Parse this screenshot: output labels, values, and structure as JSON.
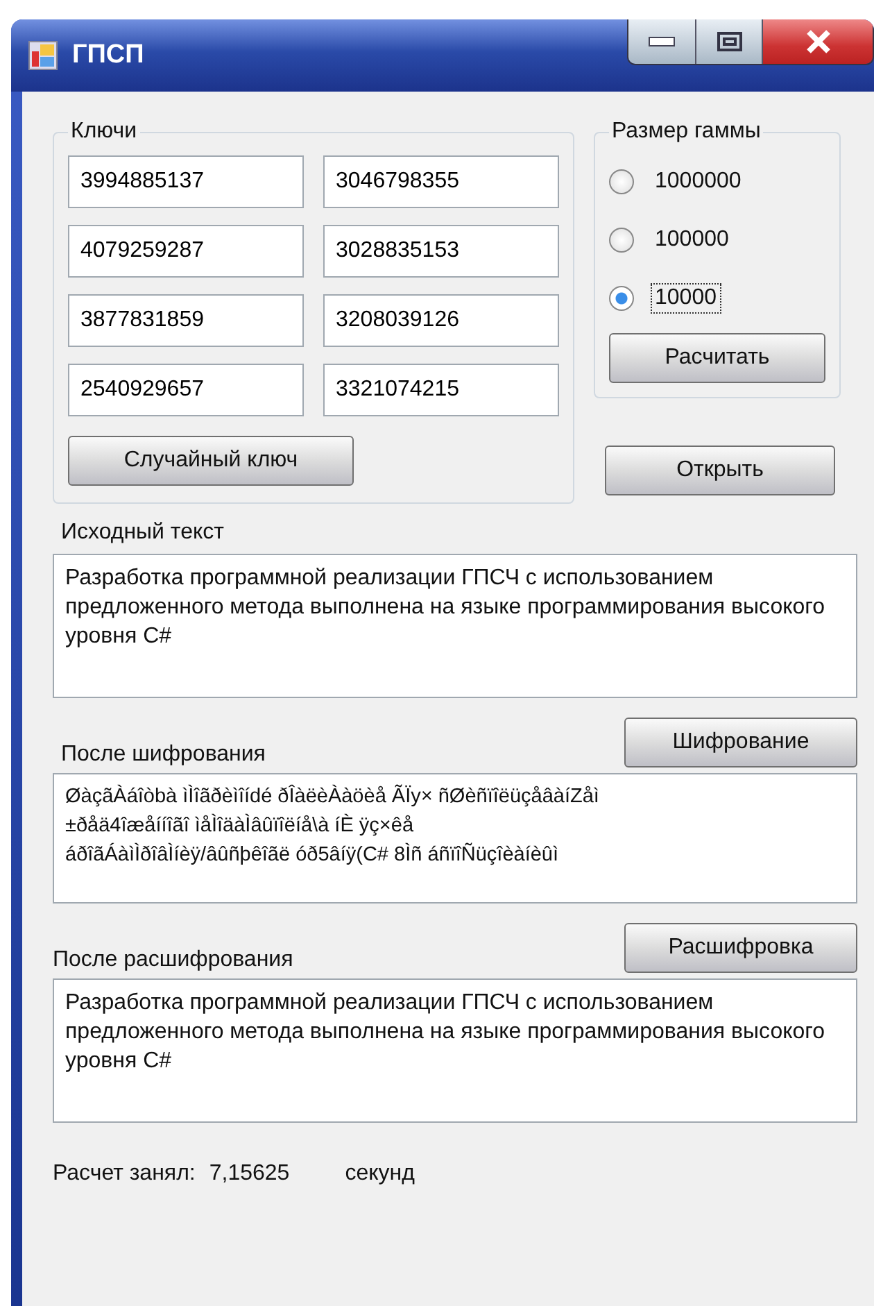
{
  "window": {
    "title": "ГПСП"
  },
  "keys": {
    "title": "Ключи",
    "values": [
      "3994885137",
      "3046798355",
      "4079259287",
      "3028835153",
      "3877831859",
      "3208039126",
      "2540929657",
      "3321074215"
    ],
    "random_button": "Случайный ключ"
  },
  "gamma_size": {
    "title": "Размер гаммы",
    "options": [
      {
        "label": "1000000",
        "selected": false
      },
      {
        "label": "100000",
        "selected": false
      },
      {
        "label": "10000",
        "selected": true
      }
    ],
    "calc_button": "Расчитать"
  },
  "open_button": "Открыть",
  "source": {
    "label": "Исходный текст",
    "text": "Разработка программной реализации ГПСЧ с использованием предложенного метода выполнена на языке программирования высокого уровня C#"
  },
  "encrypt_button": "Шифрование",
  "encrypted": {
    "label": "После шифрования",
    "text": "ØàçãÀáîòbà ìÌîãðèìîídé ðÎàëèÀàöèå ÃÏy× ñØèñïîëüçåâàíZåì\n±ðåä4îæåííîãî ìåÌîäàÌâûïîëíå\\à íÈ ÿç×êå\náðîãÁàìÌðîâÌíèÿ/âûñþêîãë óð5âíÿ(C# 8Ìñ áñïîÑüçîèàíèûì"
  },
  "decrypt_button": "Расшифровка",
  "decrypted": {
    "label": "После расшифрования",
    "text": "Разработка программной реализации ГПСЧ с использованием предложенного метода выполнена на языке программирования высокого уровня C#"
  },
  "status": {
    "label": "Расчет занял:",
    "value": "7,15625",
    "unit": "секунд"
  }
}
